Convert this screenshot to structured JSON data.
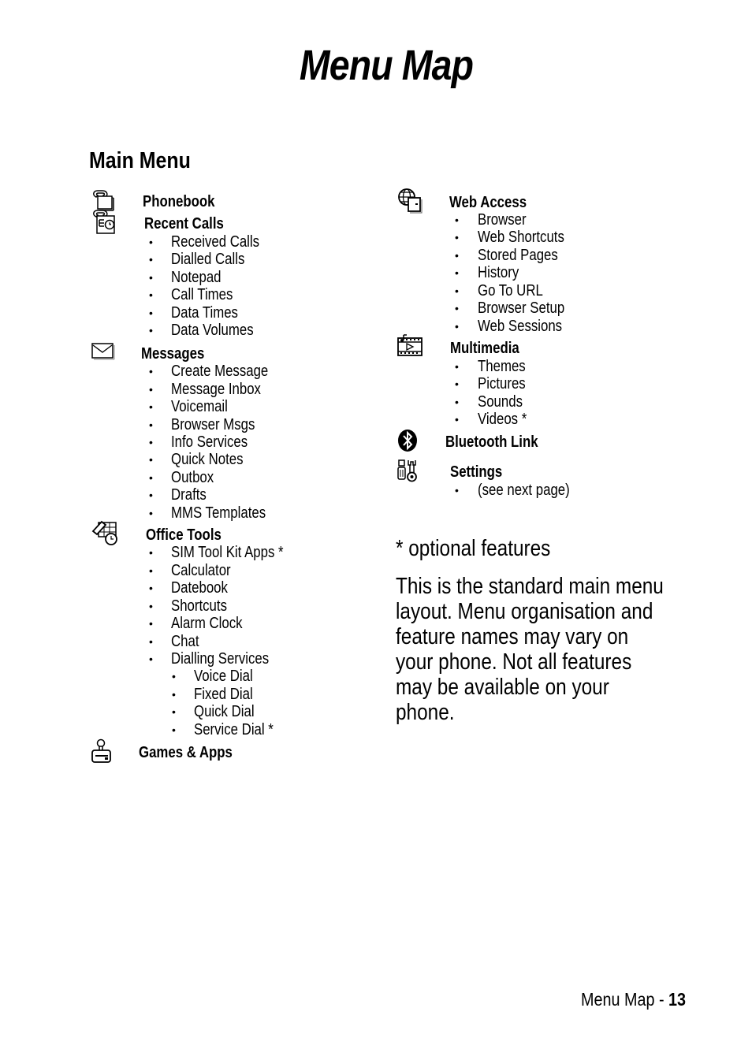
{
  "page": {
    "title": "Menu Map",
    "section_title": "Main Menu",
    "footer_label": "Menu Map - ",
    "footer_page": "13"
  },
  "left_column": [
    {
      "icon": "phonebook-icon",
      "label": "Phonebook",
      "items": []
    },
    {
      "icon": "recent-calls-icon",
      "label": "Recent Calls",
      "items": [
        "Received Calls",
        "Dialled Calls",
        "Notepad",
        "Call Times",
        "Data Times",
        "Data Volumes"
      ]
    },
    {
      "icon": "messages-envelope-icon",
      "label": "Messages",
      "items": [
        "Create Message",
        "Message Inbox",
        "Voicemail",
        "Browser Msgs",
        "Info Services",
        "Quick Notes",
        "Outbox",
        "Drafts",
        "MMS Templates"
      ]
    },
    {
      "icon": "office-tools-icon",
      "label": "Office Tools",
      "items": [
        "SIM Tool Kit Apps *",
        "Calculator",
        "Datebook",
        "Shortcuts",
        "Alarm Clock",
        "Chat",
        "Dialling Services"
      ],
      "subitems": [
        "Voice Dial",
        "Fixed Dial",
        "Quick Dial",
        "Service Dial *"
      ]
    },
    {
      "icon": "games-joystick-icon",
      "label": "Games & Apps",
      "items": []
    }
  ],
  "right_column": [
    {
      "icon": "web-access-globe-icon",
      "label": "Web Access",
      "items": [
        "Browser",
        "Web Shortcuts",
        "Stored Pages",
        "History",
        "Go To URL",
        "Browser Setup",
        "Web Sessions"
      ]
    },
    {
      "icon": "multimedia-film-icon",
      "label": "Multimedia",
      "items": [
        "Themes",
        "Pictures",
        "Sounds",
        "Videos *"
      ]
    },
    {
      "icon": "bluetooth-icon",
      "label": "Bluetooth Link",
      "items": []
    },
    {
      "icon": "settings-tools-icon",
      "label": "Settings",
      "items": [
        "(see next page)"
      ]
    }
  ],
  "notes": {
    "optional": "* optional features",
    "description_lines": [
      "This is the standard main menu",
      "layout. Menu organisation and",
      "feature names may vary on",
      "your phone. Not all features",
      "may be available on your",
      "phone."
    ]
  },
  "bullet_char": "•"
}
